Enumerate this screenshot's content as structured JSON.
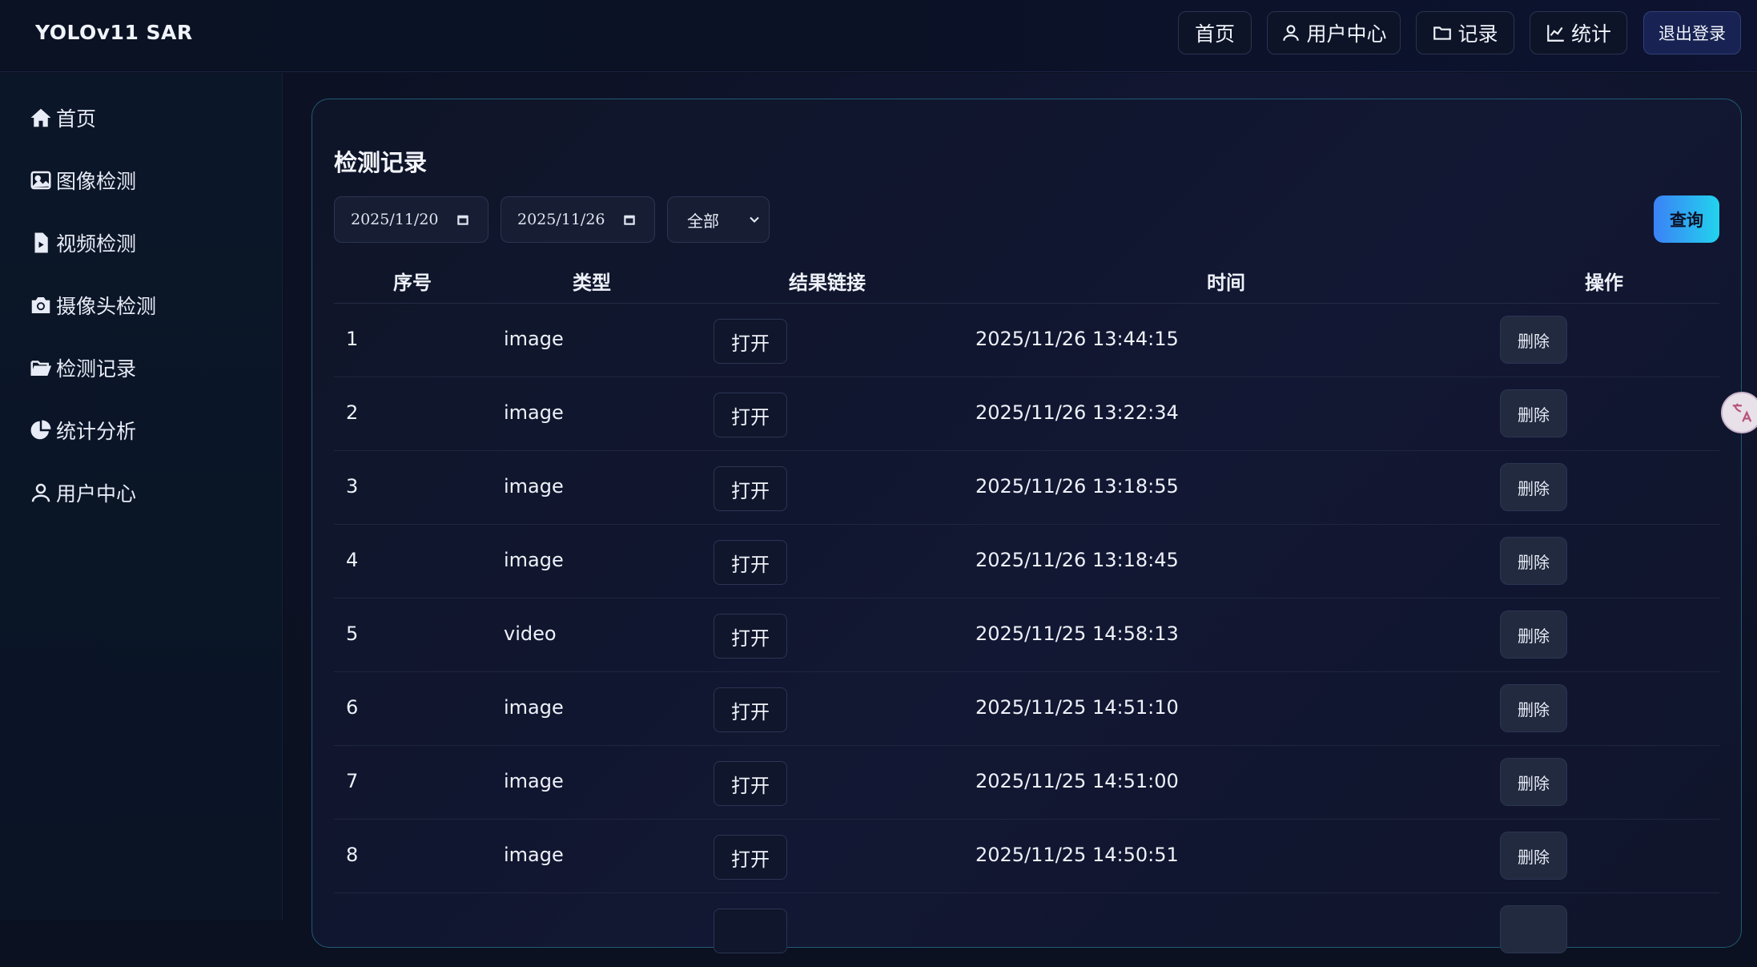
{
  "app": {
    "brand": "YOLOv11 SAR"
  },
  "topnav": {
    "home": "首页",
    "user_center": "用户中心",
    "records": "记录",
    "stats": "统计",
    "logout": "退出登录"
  },
  "sidebar": {
    "items": [
      {
        "label": "首页",
        "icon": "home-icon"
      },
      {
        "label": "图像检测",
        "icon": "image-icon"
      },
      {
        "label": "视频检测",
        "icon": "file-video-icon"
      },
      {
        "label": "摄像头检测",
        "icon": "camera-icon"
      },
      {
        "label": "检测记录",
        "icon": "folder-open-icon"
      },
      {
        "label": "统计分析",
        "icon": "pie-chart-icon"
      },
      {
        "label": "用户中心",
        "icon": "user-icon"
      }
    ]
  },
  "records": {
    "title": "检测记录",
    "filters": {
      "start_date": "2025/11/20",
      "end_date": "2025/11/26",
      "type_selected": "全部"
    },
    "query_label": "查询",
    "columns": [
      "序号",
      "类型",
      "结果链接",
      "时间",
      "操作"
    ],
    "open_label": "打开",
    "delete_label": "删除",
    "rows": [
      {
        "id": "1",
        "type": "image",
        "time": "2025/11/26 13:44:15"
      },
      {
        "id": "2",
        "type": "image",
        "time": "2025/11/26 13:22:34"
      },
      {
        "id": "3",
        "type": "image",
        "time": "2025/11/26 13:18:55"
      },
      {
        "id": "4",
        "type": "image",
        "time": "2025/11/26 13:18:45"
      },
      {
        "id": "5",
        "type": "video",
        "time": "2025/11/25 14:58:13"
      },
      {
        "id": "6",
        "type": "image",
        "time": "2025/11/25 14:51:10"
      },
      {
        "id": "7",
        "type": "image",
        "time": "2025/11/25 14:51:00"
      },
      {
        "id": "8",
        "type": "image",
        "time": "2025/11/25 14:50:51"
      }
    ]
  },
  "colors": {
    "accent_gradient_start": "#3b82f6",
    "accent_gradient_end": "#22d3ee",
    "card_border": "#1f5a73",
    "background": "#0b1120"
  }
}
